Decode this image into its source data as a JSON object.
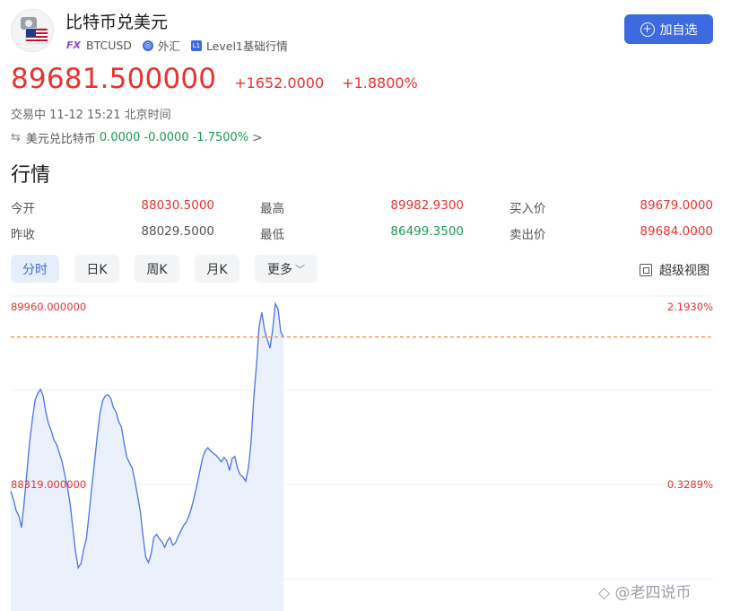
{
  "header": {
    "title": "比特币兑美元",
    "fx_badge": "FX",
    "symbol": "BTCUSD",
    "category": "外汇",
    "level_badge": "L1",
    "level": "Level1基础行情",
    "add_button": "加自选",
    "icons": [
      "dollar-coin-icon",
      "us-flag-icon",
      "globe-icon",
      "level1-icon",
      "plus-circle-icon"
    ]
  },
  "price": {
    "last": "89681.500000",
    "change": "+1652.0000",
    "change_pct": "+1.8800%",
    "status": "交易中 11-12 15:21 北京时间"
  },
  "reverse": {
    "label": "美元兑比特币",
    "price": "0.0000",
    "change": "-0.0000",
    "change_pct": "-1.7500%",
    "chevron": ">"
  },
  "quote": {
    "title": "行情",
    "open_label": "今开",
    "open": "88030.5000",
    "high_label": "最高",
    "high": "89982.9300",
    "bid_label": "买入价",
    "bid": "89679.0000",
    "prev_close_label": "昨收",
    "prev_close": "88029.5000",
    "low_label": "最低",
    "low": "86499.3500",
    "ask_label": "卖出价",
    "ask": "89684.0000"
  },
  "tabs": [
    "分时",
    "日K",
    "周K",
    "月K",
    "更多"
  ],
  "super_view": "超级视图",
  "chart_data": {
    "type": "line",
    "y_axis_labels": [
      "89960.000000",
      "88319.000000"
    ],
    "pct_axis_labels": [
      "2.1930%",
      "0.3289%"
    ],
    "y_axis_values": [
      89960,
      88319
    ],
    "reference_price": 89681.5,
    "line_color": "#4a73e8",
    "fill_color": "#e8eefc",
    "values": [
      88259,
      88180,
      88079,
      88030,
      87921,
      88159,
      88439,
      88719,
      88919,
      89099,
      89159,
      89199,
      89138,
      88989,
      88879,
      88819,
      88729,
      88689,
      88609,
      88529,
      88409,
      88289,
      88139,
      87919,
      87699,
      87549,
      87589,
      87719,
      87819,
      88049,
      88289,
      88519,
      88759,
      88969,
      89089,
      89139,
      89149,
      89119,
      89029,
      88989,
      88899,
      88849,
      88699,
      88569,
      88519,
      88469,
      88349,
      88209,
      88069,
      87839,
      87649,
      87599,
      87679,
      87829,
      87859,
      87819,
      87789,
      87739,
      87799,
      87829,
      87759,
      87779,
      87839,
      87889,
      87939,
      87969,
      88029,
      88109,
      88209,
      88319,
      88439,
      88559,
      88629,
      88659,
      88629,
      88609,
      88589,
      88559,
      88529,
      88569,
      88539,
      88449,
      88559,
      88579,
      88469,
      88409,
      88389,
      88349,
      88469,
      88709,
      89119,
      89419,
      89779,
      89909,
      89749,
      89659,
      89579,
      89749,
      89989,
      89939,
      89729,
      89681
    ]
  },
  "watermark": "◇ @老四说币"
}
